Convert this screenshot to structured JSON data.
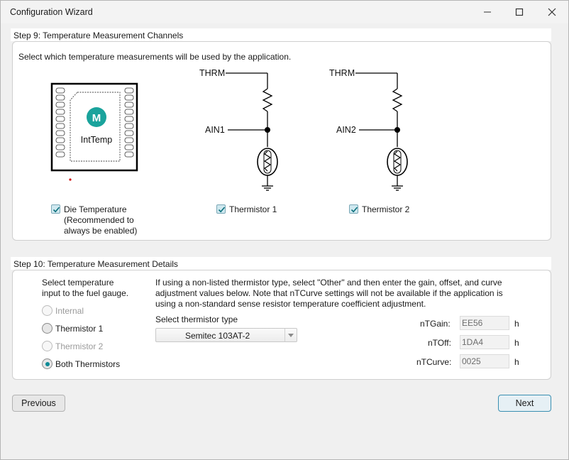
{
  "window": {
    "title": "Configuration Wizard",
    "accent": "#0a8a96"
  },
  "step9": {
    "header": "Step 9: Temperature Measurement Channels",
    "instruction": "Select which temperature measurements will be used by the application.",
    "chip": {
      "label": "IntTemp",
      "logo_text": "M"
    },
    "circuit1": {
      "top_label": "THRM",
      "mid_label": "AIN1"
    },
    "circuit2": {
      "top_label": "THRM",
      "mid_label": "AIN2"
    },
    "options": {
      "die_line1": "Die Temperature",
      "die_line2": "(Recommended to",
      "die_line3": "always be enabled)",
      "die_checked": true,
      "thermistor1": "Thermistor 1",
      "thermistor1_checked": true,
      "thermistor2": "Thermistor 2",
      "thermistor2_checked": true
    }
  },
  "step10": {
    "header": "Step 10: Temperature Measurement Details",
    "select_line1": "Select temperature",
    "select_line2": "input to the fuel gauge.",
    "radios": [
      "Internal",
      "Thermistor 1",
      "Thermistor 2",
      "Both Thermistors"
    ],
    "selected_radio": "Both Thermistors",
    "info_line1": "If using a non-listed thermistor type, select \"Other\" and then enter the gain, offset, and curve",
    "info_line2": "adjustment values below. Note that nTCurve settings will not be available if the application is",
    "info_line3": "using a non-standard sense resistor temperature coefficient adjustment.",
    "type_label": "Select thermistor type",
    "type_value": "Semitec 103AT-2",
    "fields": [
      {
        "label": "nTGain:",
        "value": "EE56",
        "unit": "h"
      },
      {
        "label": "nTOff:",
        "value": "1DA4",
        "unit": "h"
      },
      {
        "label": "nTCurve:",
        "value": "0025",
        "unit": "h"
      }
    ]
  },
  "buttons": {
    "previous": "Previous",
    "next": "Next"
  }
}
